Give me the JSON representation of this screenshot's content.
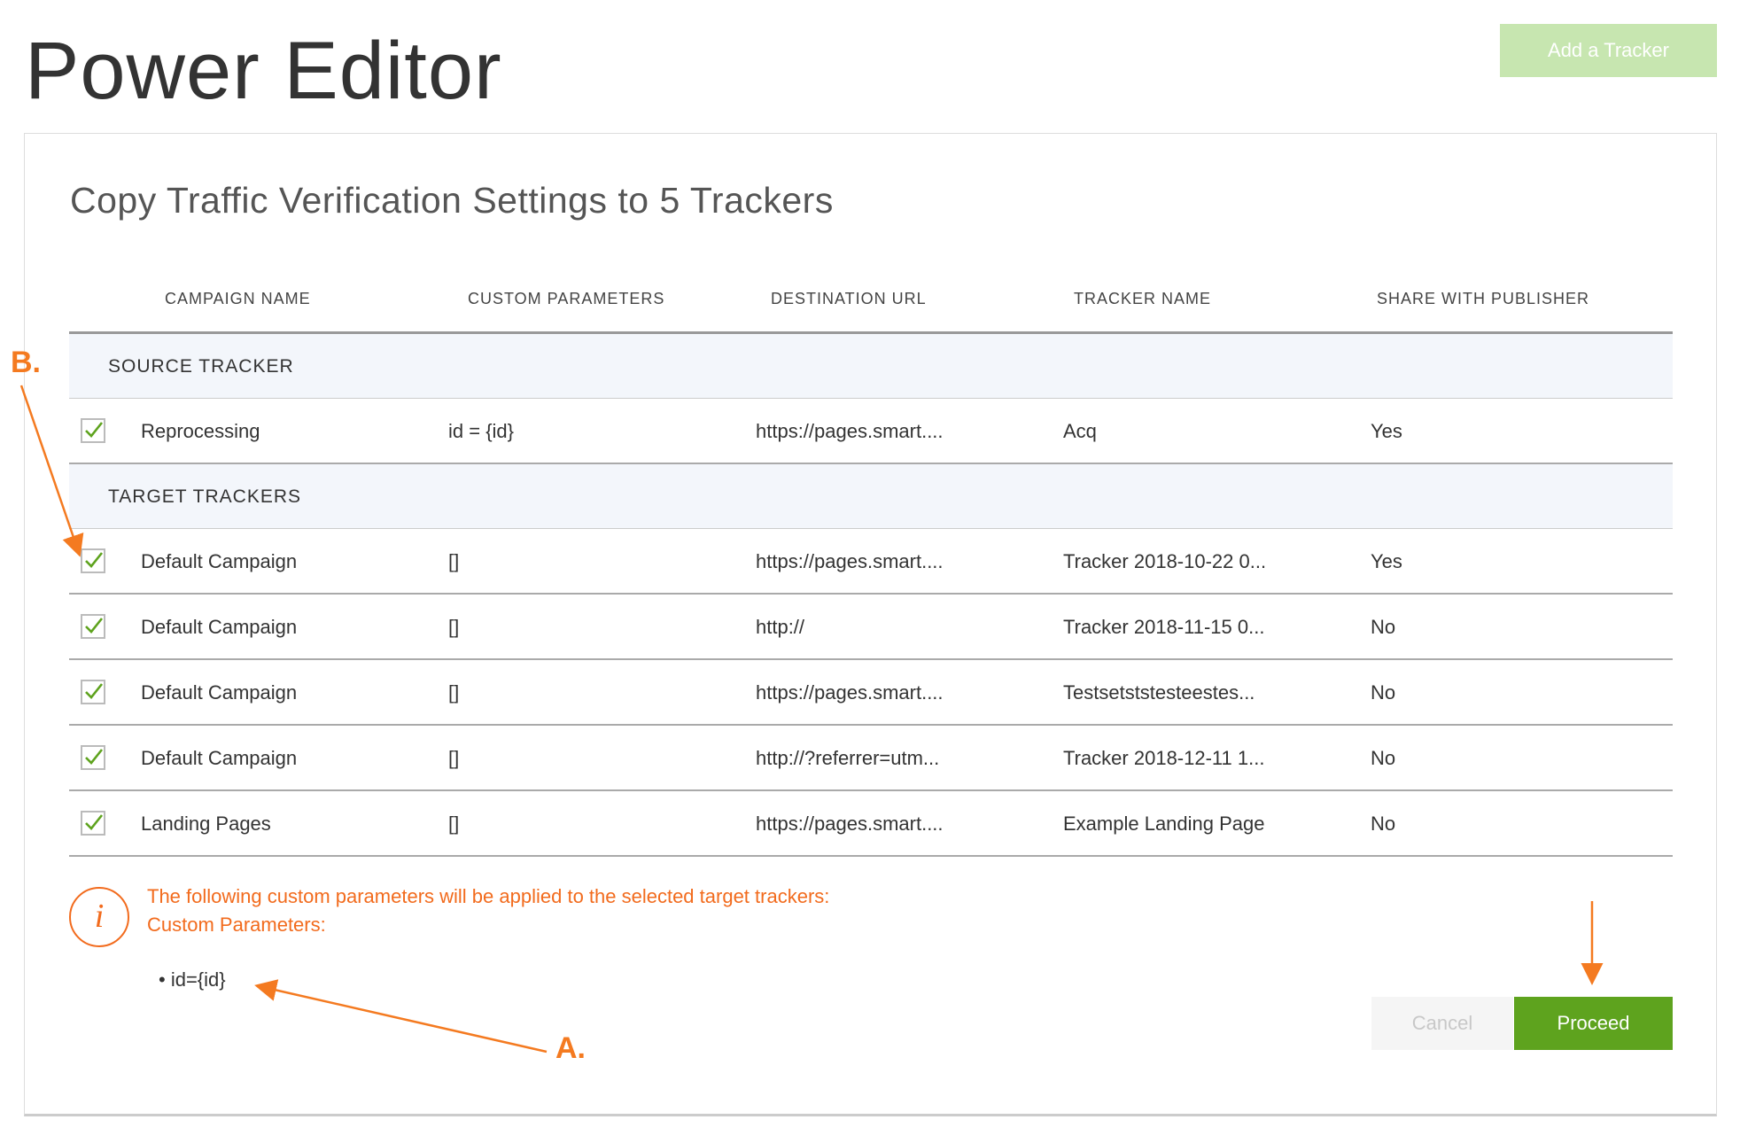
{
  "page_title": "Power Editor",
  "add_tracker_label": "Add a Tracker",
  "card_title": "Copy Traffic Verification Settings to 5 Trackers",
  "columns": [
    "CAMPAIGN NAME",
    "CUSTOM PARAMETERS",
    "DESTINATION URL",
    "TRACKER NAME",
    "SHARE WITH PUBLISHER"
  ],
  "source_section_label": "SOURCE TRACKER",
  "target_section_label": "TARGET TRACKERS",
  "source_row": {
    "checked": true,
    "campaign": "Reprocessing",
    "params": "id = {id}",
    "url": "https://pages.smart....",
    "tracker": "Acq",
    "share": "Yes"
  },
  "target_rows": [
    {
      "checked": true,
      "campaign": "Default Campaign",
      "params": "[]",
      "url": "https://pages.smart....",
      "tracker": "Tracker 2018-10-22 0...",
      "share": "Yes"
    },
    {
      "checked": true,
      "campaign": "Default Campaign",
      "params": "[]",
      "url": "http://",
      "tracker": "Tracker 2018-11-15 0...",
      "share": "No"
    },
    {
      "checked": true,
      "campaign": "Default Campaign",
      "params": "[]",
      "url": "https://pages.smart....",
      "tracker": "Testsetststesteestes...",
      "share": "No"
    },
    {
      "checked": true,
      "campaign": "Default Campaign",
      "params": "[]",
      "url": "http://?referrer=utm...",
      "tracker": "Tracker 2018-12-11 1...",
      "share": "No"
    },
    {
      "checked": true,
      "campaign": "Landing Pages",
      "params": "[]",
      "url": "https://pages.smart....",
      "tracker": "Example Landing Page",
      "share": "No"
    }
  ],
  "info": {
    "icon": "info-icon",
    "glyph": "i",
    "line1": "The following custom parameters will be applied to the selected target trackers:",
    "line2": "Custom Parameters:",
    "params": [
      "id={id}"
    ],
    "color": "#f26b1d"
  },
  "buttons": {
    "cancel": "Cancel",
    "proceed": "Proceed"
  },
  "annotations": {
    "a": "A.",
    "b": "B.",
    "color": "#f47a20"
  },
  "colors": {
    "accent_green": "#5ea31e",
    "disabled_green": "#c7e6b0",
    "check_green": "#5ea31e"
  }
}
